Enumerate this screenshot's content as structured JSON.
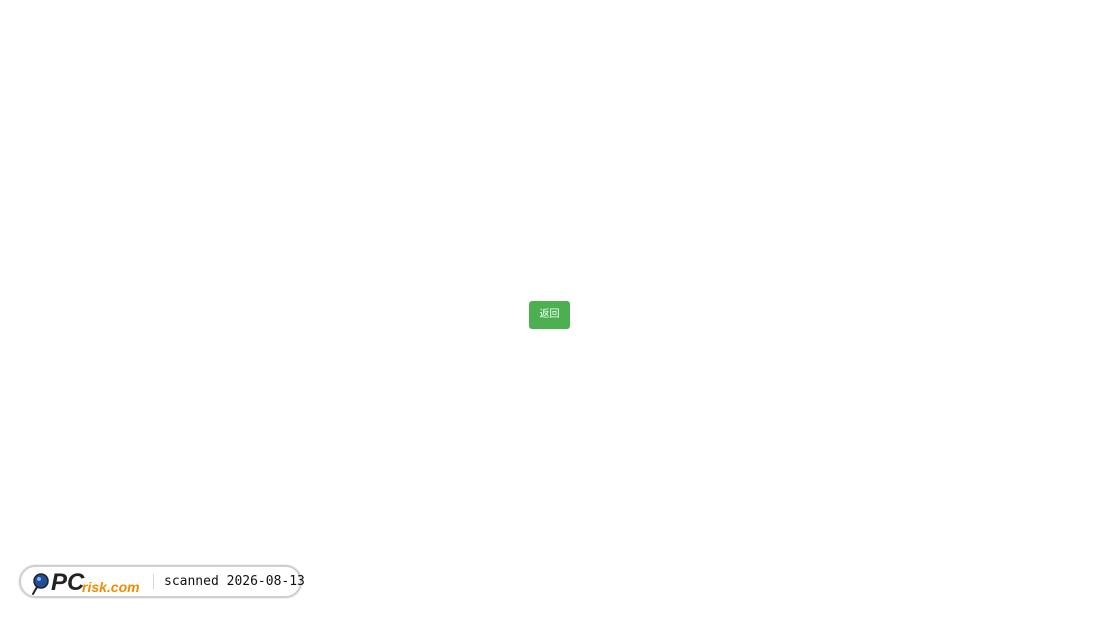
{
  "main": {
    "back_label": "返回",
    "button_color": "#4caf50"
  },
  "watermark": {
    "logo_icon": "magnifier-logo-icon",
    "logo_text_primary": "PC",
    "logo_text_secondary": "risk.com",
    "scan_text": "scanned 2026-08-13",
    "colors": {
      "primary": "#1f4d9a",
      "secondary": "#f28c00",
      "dark": "#222222"
    }
  }
}
